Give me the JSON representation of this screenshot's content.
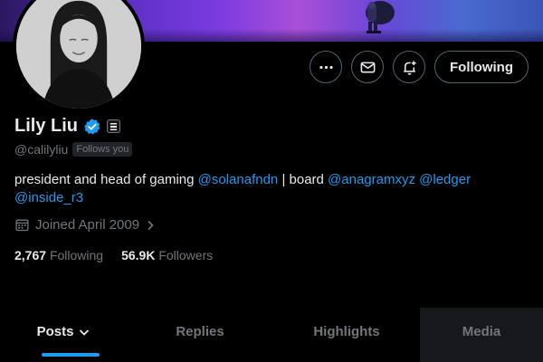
{
  "profile": {
    "display_name": "Lily Liu",
    "handle": "@calilyliu",
    "follows_you": "Follows you",
    "bio": {
      "part1": "president and head of gaming ",
      "mention1": "@solanafndn",
      "part2": " | board ",
      "mention2": "@anagramxyz",
      "space": " ",
      "mention3": "@ledger",
      "mention4": "@inside_r3"
    },
    "joined": "Joined April 2009",
    "following_count": "2,767",
    "following_label": "Following",
    "followers_count": "56.9K",
    "followers_label": "Followers"
  },
  "actions": {
    "more_icon": "ellipsis-icon",
    "message_icon": "envelope-icon",
    "notify_icon": "bell-plus-icon",
    "follow_label": "Following"
  },
  "tabs": [
    {
      "label": "Posts"
    },
    {
      "label": "Replies"
    },
    {
      "label": "Highlights"
    },
    {
      "label": "Media"
    }
  ],
  "colors": {
    "accent": "#1d9bf0",
    "background": "#000000",
    "muted": "#71767b",
    "text": "#e7e9ea"
  }
}
